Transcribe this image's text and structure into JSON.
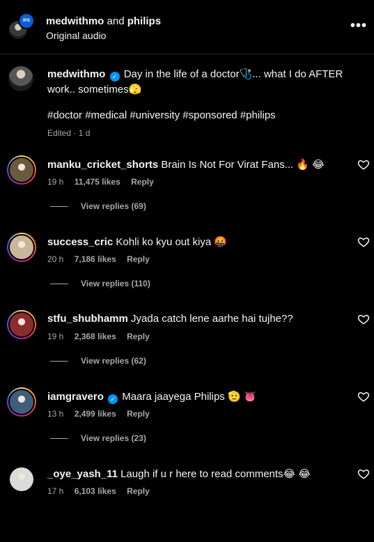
{
  "header": {
    "user1": "medwithmo",
    "and_text": "and",
    "user2": "philips",
    "badge_text": "IPS",
    "subtitle": "Original audio",
    "more_icon": "more-horizontal-icon"
  },
  "caption": {
    "username": "medwithmo",
    "text": "Day in the life of a doctor🩺... what I do AFTER work.. sometimes🫣",
    "hashtags": "#doctor #medical #university #sponsored #philips",
    "meta": "Edited · 1 d"
  },
  "comments": [
    {
      "username": "manku_cricket_shorts",
      "verified": false,
      "text": "Brain Is Not For Virat Fans... 🔥 😂",
      "time": "19 h",
      "likes": "11,475 likes",
      "reply": "Reply",
      "view_replies": "View replies (69)",
      "avatar_color": "#6b5a3e"
    },
    {
      "username": "success_cric",
      "verified": false,
      "text": "Kohli ko kyu out kiya 🤬",
      "time": "20 h",
      "likes": "7,186 likes",
      "reply": "Reply",
      "view_replies": "View replies (110)",
      "avatar_color": "#c9b79a"
    },
    {
      "username": "stfu_shubhamm",
      "verified": false,
      "text": "Jyada catch lene aarhe hai tujhe??",
      "time": "19 h",
      "likes": "2,368 likes",
      "reply": "Reply",
      "view_replies": "View replies (62)",
      "avatar_color": "#8a2d2d"
    },
    {
      "username": "iamgravero",
      "verified": true,
      "text": "Maara jaayega Philips 🫡 👅",
      "time": "13 h",
      "likes": "2,499 likes",
      "reply": "Reply",
      "view_replies": "View replies (23)",
      "avatar_color": "#3e5f7a"
    },
    {
      "username": "_oye_yash_11",
      "verified": false,
      "text": "Laugh if u r here to read comments😂 😂",
      "time": "17 h",
      "likes": "6,103 likes",
      "reply": "Reply",
      "view_replies": "",
      "avatar_color": "#dbdbdb"
    }
  ]
}
